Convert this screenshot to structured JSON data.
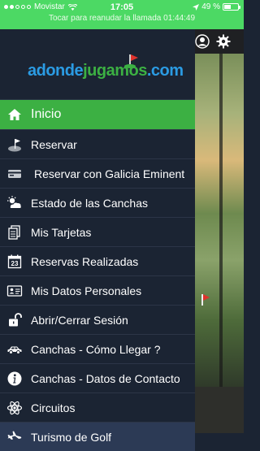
{
  "status_bar": {
    "carrier": "Movistar",
    "time": "17:05",
    "battery": "49 %",
    "battery_level": 0.49,
    "call_banner": "Tocar para reanudar la llamada 01:44:49"
  },
  "brand": {
    "logo_text_blue_1": "adonde",
    "logo_text_green": "jugamos",
    "logo_text_blue_2": ".com",
    "colors": {
      "blue": "#2b9be3",
      "green": "#3cb043",
      "red": "#e0322c"
    }
  },
  "menu": {
    "items": [
      {
        "label": "Inicio",
        "icon": "home-icon",
        "active": true
      },
      {
        "label": "Reservar",
        "icon": "golf-hole-icon"
      },
      {
        "label": "Reservar con Galicia Eminent",
        "icon": "card-icon"
      },
      {
        "label": "Estado de las Canchas",
        "icon": "weather-icon"
      },
      {
        "label": "Mis Tarjetas",
        "icon": "scorecards-icon"
      },
      {
        "label": "Reservas Realizadas",
        "icon": "calendar-icon"
      },
      {
        "label": "Mis Datos Personales",
        "icon": "id-card-icon"
      },
      {
        "label": "Abrir/Cerrar Sesión",
        "icon": "lock-icon"
      },
      {
        "label": "Canchas - Cómo Llegar ?",
        "icon": "car-icon"
      },
      {
        "label": "Canchas - Datos de Contacto",
        "icon": "info-icon"
      },
      {
        "label": "Circuitos",
        "icon": "atom-icon"
      },
      {
        "label": "Turismo de Golf",
        "icon": "airplane-icon"
      }
    ]
  },
  "calendar_icon_number": "23",
  "background_header": {
    "icons": [
      "user-icon",
      "gear-icon"
    ]
  }
}
